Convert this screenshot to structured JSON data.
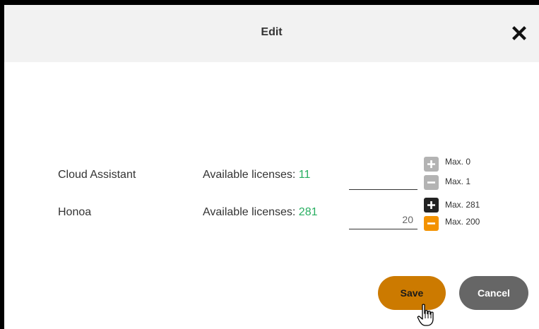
{
  "dialog": {
    "title": "Edit",
    "close_icon": "close-icon"
  },
  "licenses": [
    {
      "product": "Cloud Assistant",
      "available_label": "Available licenses:",
      "available_count": "11",
      "quantity": "",
      "increment": {
        "icon": "plus-icon",
        "state": "disabled",
        "max_label": "Max. 0"
      },
      "decrement": {
        "icon": "minus-icon",
        "state": "disabled",
        "max_label": "Max. 1"
      }
    },
    {
      "product": "Honoa",
      "available_label": "Available licenses:",
      "available_count": "281",
      "quantity": "20",
      "increment": {
        "icon": "plus-icon",
        "state": "enabled",
        "max_label": "Max. 281"
      },
      "decrement": {
        "icon": "minus-icon",
        "state": "active",
        "max_label": "Max. 200"
      }
    }
  ],
  "actions": {
    "save_label": "Save",
    "cancel_label": "Cancel"
  },
  "colors": {
    "header_bg": "#f2f2f2",
    "available_count": "#27ae60",
    "save_bg": "#cc7a00",
    "cancel_bg": "#666666",
    "decrement_active": "#f39200",
    "stepper_disabled": "#b3b3b3",
    "stepper_enabled": "#222222"
  }
}
